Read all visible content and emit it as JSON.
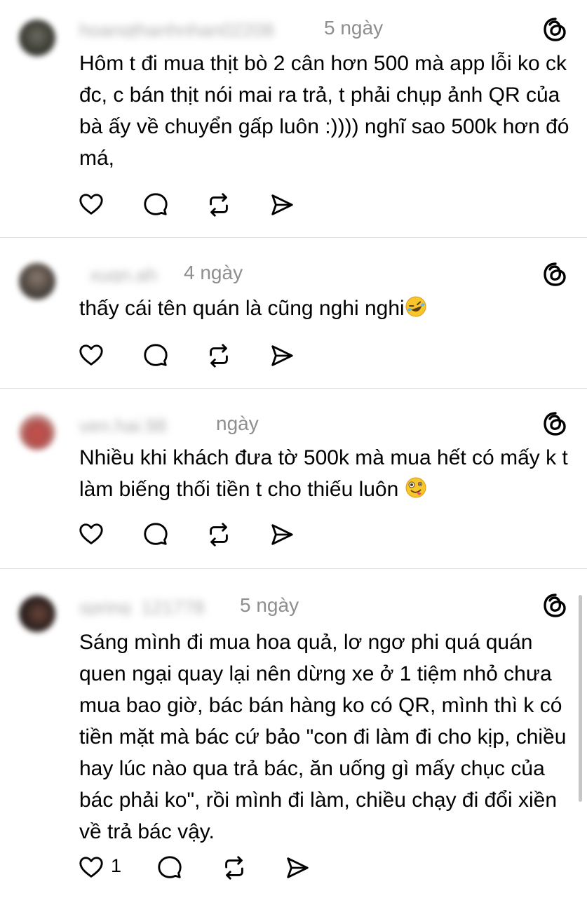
{
  "icons": {
    "like": "heart-icon",
    "reply": "speech-bubble-icon",
    "repost": "repost-icon",
    "share": "send-icon",
    "app": "threads-logo-icon"
  },
  "colors": {
    "text": "#000000",
    "meta": "#8e8e8e",
    "divider": "#e2e2e2"
  },
  "posts": [
    {
      "username": "hoangthanhnhan02208",
      "time": "5 ngày",
      "text": "Hôm t đi mua thịt bò 2 cân hơn 500 mà app lỗi ko ck đc, c bán thịt nói mai ra trả, t phải chụp ảnh QR của bà ấy về chuyển gấp luôn :)))) nghĩ sao 500k hơn đó má,",
      "emoji": "",
      "likes": ""
    },
    {
      "username": "_xuqn.ah",
      "time": "4 ngày",
      "text": "thấy cái tên quán là cũng nghi nghi",
      "emoji": "rolling-on-floor-laughing-emoji",
      "likes": ""
    },
    {
      "username": "yen.hai.98",
      "time": "ngày",
      "text": "Nhiều khi khách đưa tờ 500k mà mua hết có mấy k t làm biếng thối tiền t cho thiếu luôn ",
      "emoji": "zany-face-emoji",
      "likes": ""
    },
    {
      "username": "spring_121778",
      "time": "5 ngày",
      "text": "Sáng mình đi mua hoa quả, lơ ngơ phi quá quán quen ngại quay lại nên dừng xe ở 1 tiệm nhỏ chưa mua bao giờ, bác bán hàng ko có QR, mình thì k có tiền mặt mà bác cứ bảo \"con đi làm đi cho kịp, chiều hay lúc nào qua trả bác, ăn uống gì mấy chục của bác phải ko\", rồi mình đi làm, chiều chạy đi đổi xiền về trả bác vậy.",
      "emoji": "",
      "likes": "1"
    }
  ]
}
